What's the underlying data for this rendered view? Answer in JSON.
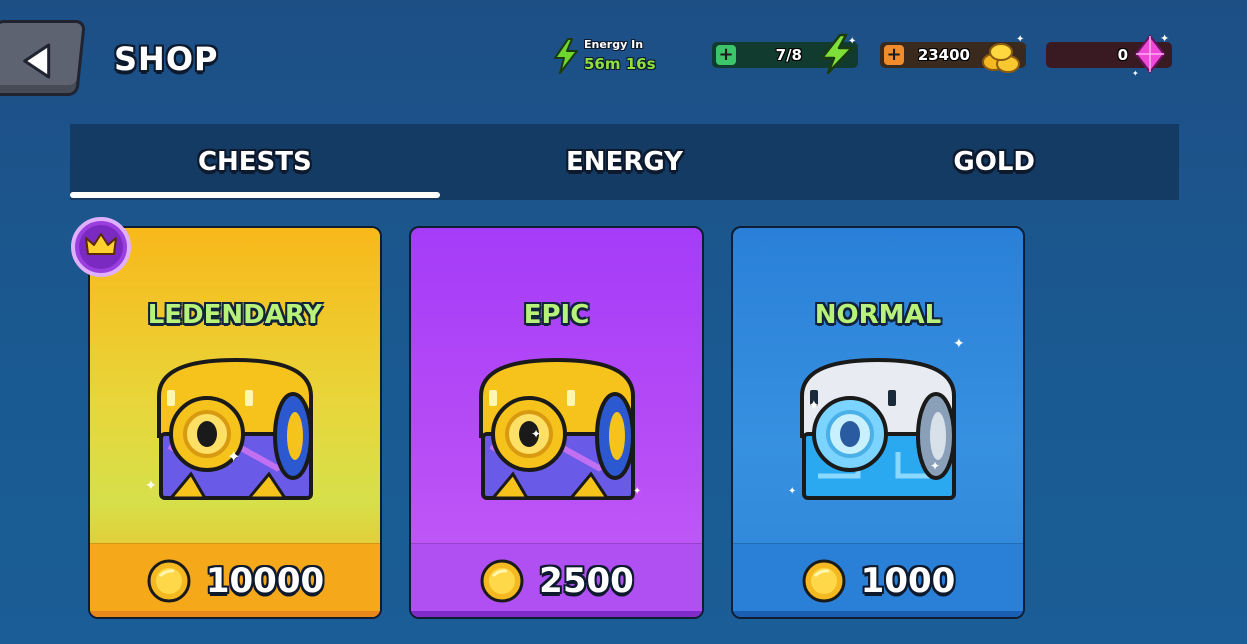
{
  "header": {
    "title": "SHOP",
    "energy_timer_label": "Energy In",
    "energy_timer_value": "56m 16s"
  },
  "resources": {
    "energy": {
      "value": "7/8",
      "icon": "lightning-bolt-icon"
    },
    "gold": {
      "value": "23400",
      "icon": "gold-coins-icon"
    },
    "gems": {
      "value": "0",
      "icon": "pink-gem-icon"
    }
  },
  "tabs": [
    {
      "label": "CHESTS",
      "active": true
    },
    {
      "label": "ENERGY",
      "active": false
    },
    {
      "label": "GOLD",
      "active": false
    }
  ],
  "chests": [
    {
      "name": "LEDENDARY",
      "price": "10000",
      "badge": "crown-icon"
    },
    {
      "name": "EPIC",
      "price": "2500"
    },
    {
      "name": "NORMAL",
      "price": "1000"
    }
  ],
  "colors": {
    "background": "#1b5590",
    "legendary": "#f8b81a",
    "epic": "#a53cf8",
    "normal": "#2a80d8",
    "chest_name": "#b8f27a",
    "energy_green": "#8ee03c"
  }
}
